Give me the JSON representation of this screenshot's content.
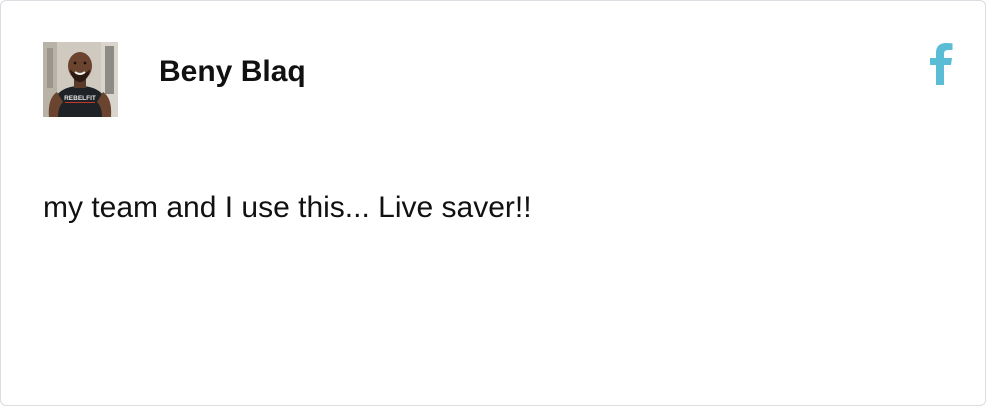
{
  "review": {
    "author": "Beny Blaq",
    "avatar_icon": "avatar-photo",
    "avatar_shirt_text": "REBELFIT",
    "source_icon": "facebook-icon",
    "source_color": "#5bbcd6",
    "text": "my team and I use this... Live saver!!"
  }
}
